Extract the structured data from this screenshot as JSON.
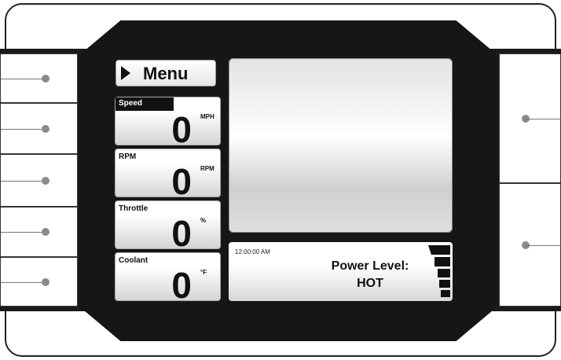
{
  "menu": {
    "label": "Menu"
  },
  "gauges": [
    {
      "label": "Speed",
      "value": "0",
      "unit": "MPH"
    },
    {
      "label": "RPM",
      "value": "0",
      "unit": "RPM"
    },
    {
      "label": "Throttle",
      "value": "0",
      "unit": "%"
    },
    {
      "label": "Coolant",
      "value": "0",
      "unit": "°F"
    }
  ],
  "status": {
    "time": "12:00:00 AM",
    "power_title": "Power Level:",
    "power_value": "HOT",
    "level_bars": 5
  },
  "colors": {
    "panel": "#161616",
    "accent": "#111111"
  }
}
